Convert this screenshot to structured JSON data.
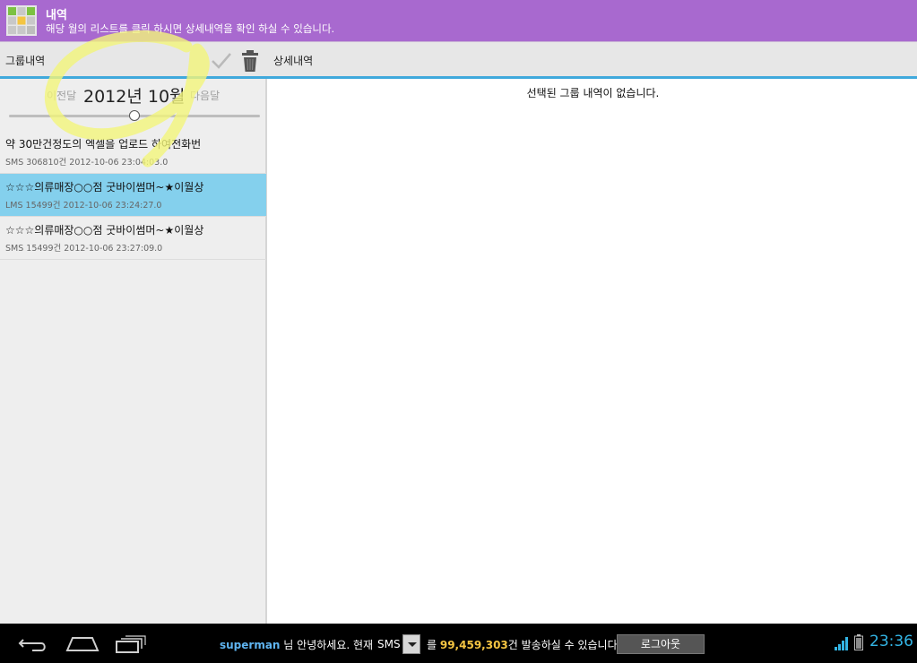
{
  "titlebar": {
    "title": "내역",
    "subtitle": "해당 월의 리스트를 클릭 하시면 상세내역을 확인 하실 수 있습니다."
  },
  "actionbar": {
    "left_label": "그룹내역",
    "right_label": "상세내역",
    "icons": [
      "check-icon",
      "trash-icon"
    ]
  },
  "month": {
    "prev_label": "이전달",
    "title": "2012년 10월",
    "next_label": "다음달",
    "slider_value": 0.5
  },
  "list": {
    "items": [
      {
        "title": "약 30만건정도의 엑셀을 업로드 하여전화번",
        "sub": "SMS 306810건 2012-10-06 23:04:03.0",
        "selected": false
      },
      {
        "title": "☆☆☆의류매장○○점 굿바이썸머~★이월상",
        "sub": "LMS 15499건 2012-10-06 23:24:27.0",
        "selected": true
      },
      {
        "title": "☆☆☆의류매장○○점 굿바이썸머~★이월상",
        "sub": "SMS 15499건 2012-10-06 23:27:09.0",
        "selected": false
      }
    ]
  },
  "detail": {
    "empty_message": "선택된 그룹 내역이 없습니다."
  },
  "statusbar": {
    "username": "superman",
    "greeting": " 님 안녕하세요. 현재",
    "sms_label": "SMS",
    "send_prefix": "를 ",
    "send_count": "99,459,303",
    "send_suffix": "건 발송하실 수 있습니다.",
    "logout_label": "로그아웃",
    "time": "23:36"
  },
  "colors": {
    "titlebar": "#a869cf",
    "accent": "#40a9dc",
    "selected_row": "#84d0ed",
    "highlight": "#f3f57a",
    "clock": "#33b5e5"
  }
}
